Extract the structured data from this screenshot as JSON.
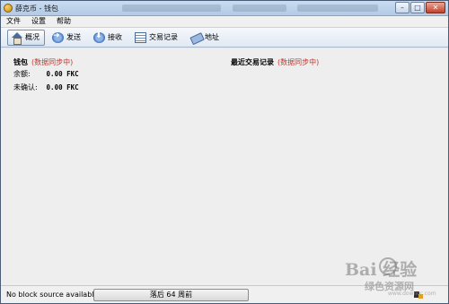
{
  "window": {
    "title": "薛克币 - 钱包"
  },
  "menu": {
    "items": [
      "文件",
      "设置",
      "帮助"
    ]
  },
  "toolbar": {
    "overview": "概况",
    "send": "发送",
    "receive": "接收",
    "history": "交易记录",
    "address": "地址"
  },
  "wallet": {
    "title": "钱包",
    "sync_status": "(数据同步中)",
    "balance_label": "余额:",
    "balance_value": "0.00 FKC",
    "unconfirmed_label": "未确认:",
    "unconfirmed_value": "0.00 FKC"
  },
  "recent": {
    "title": "最近交易记录",
    "sync_status": "(数据同步中)"
  },
  "status": {
    "text": "No block source available...",
    "progress_text": "落后 64 周前"
  },
  "watermark": {
    "brand": "Bai  经验",
    "sub": "绿色资源网",
    "url": "www.downcc.com"
  }
}
